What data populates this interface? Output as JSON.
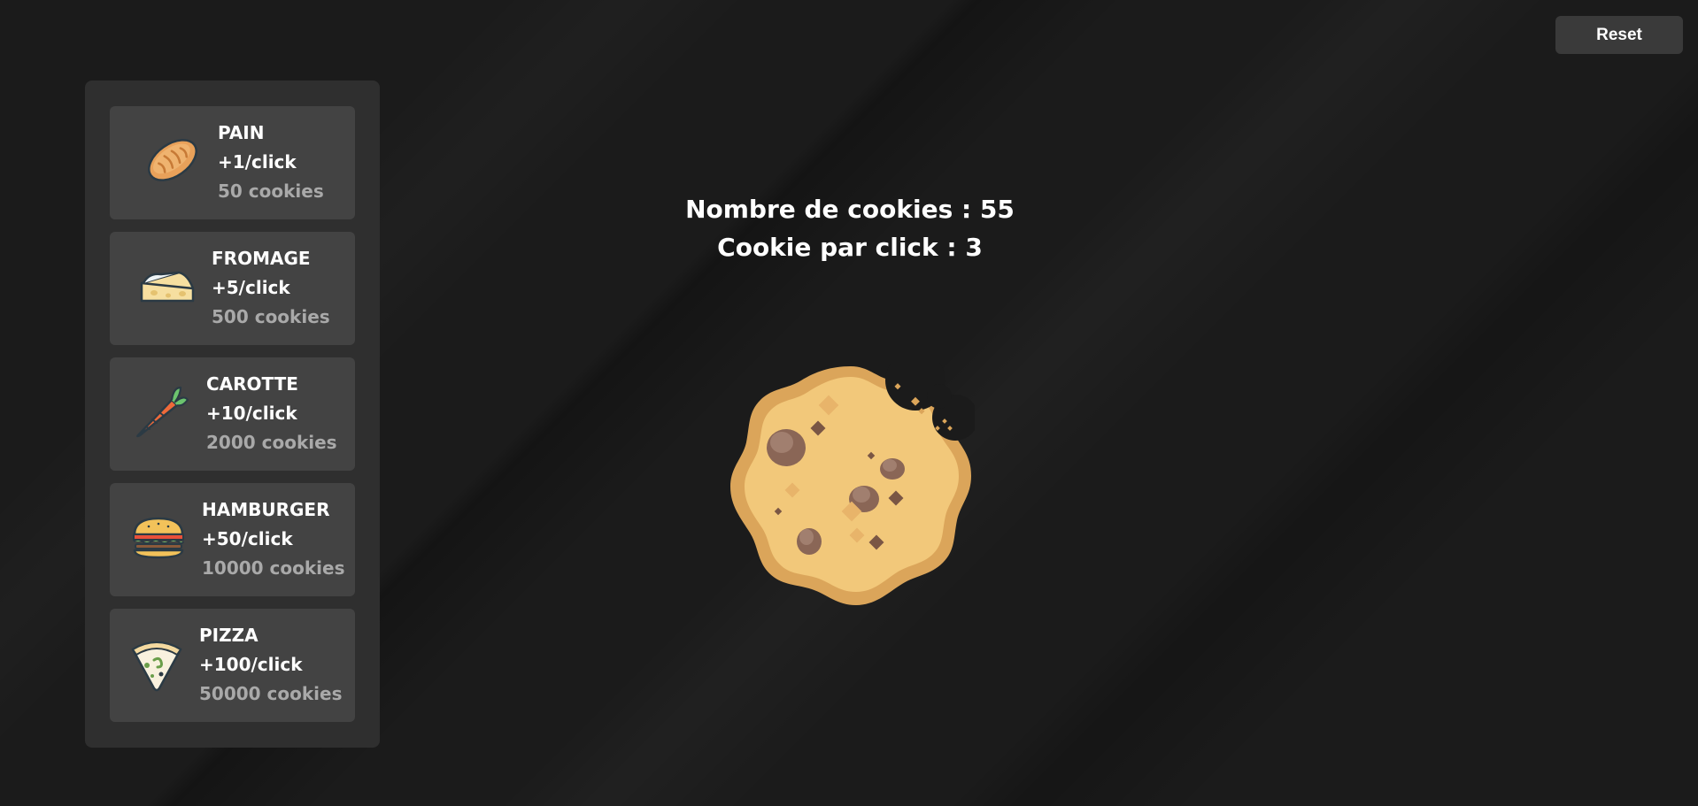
{
  "toolbar": {
    "reset_label": "Reset"
  },
  "stats": {
    "cookies_text": "Nombre de cookies : 55",
    "per_click_text": "Cookie par click : 3"
  },
  "shop": {
    "items": [
      {
        "icon": "bread-icon",
        "name": "PAIN",
        "bonus": "+1/click",
        "cost": "50 cookies"
      },
      {
        "icon": "cheese-icon",
        "name": "FROMAGE",
        "bonus": "+5/click",
        "cost": "500 cookies"
      },
      {
        "icon": "carrot-icon",
        "name": "CAROTTE",
        "bonus": "+10/click",
        "cost": "2000 cookies"
      },
      {
        "icon": "hamburger-icon",
        "name": "HAMBURGER",
        "bonus": "+50/click",
        "cost": "10000 cookies"
      },
      {
        "icon": "pizza-icon",
        "name": "PIZZA",
        "bonus": "+100/click",
        "cost": "50000 cookies"
      }
    ]
  },
  "colors": {
    "background": "#1b1b1b",
    "panel": "#2f2f2f",
    "item": "#434343",
    "cost_text": "#a9a9a9",
    "cookie_dough": "#f2c87a",
    "cookie_edge": "#dba55a",
    "chocolate": "#8a6656"
  }
}
